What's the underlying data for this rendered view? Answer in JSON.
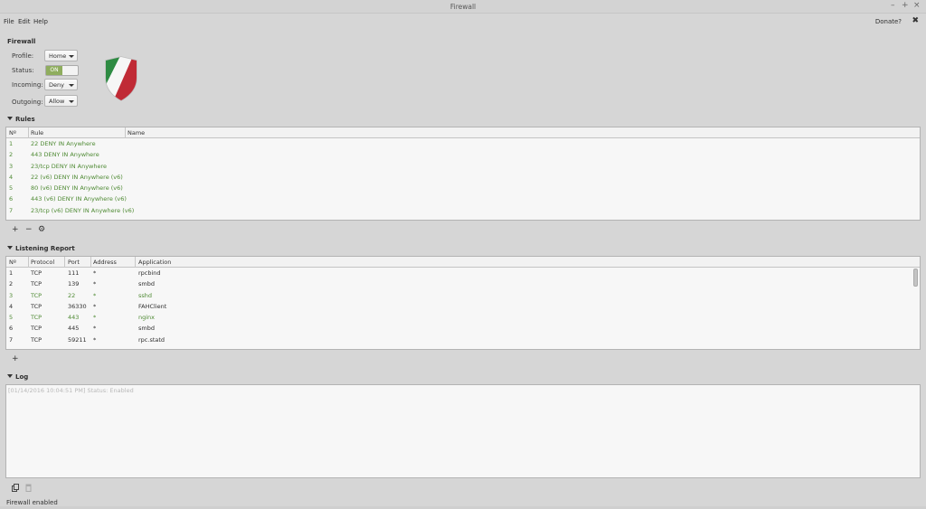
{
  "window": {
    "title": "Firewall",
    "controls": {
      "minimize": "–",
      "maximize": "+",
      "close": "×"
    }
  },
  "menu": {
    "file": "File",
    "edit": "Edit",
    "help": "Help"
  },
  "header": {
    "donate": "Donate?",
    "close_symbol": "✖"
  },
  "firewall": {
    "title": "Firewall",
    "profile_label": "Profile:",
    "profile_value": "Home",
    "status_label": "Status:",
    "status_value": "ON",
    "incoming_label": "Incoming:",
    "incoming_value": "Deny",
    "outgoing_label": "Outgoing:",
    "outgoing_value": "Allow"
  },
  "rules": {
    "title": "Rules",
    "columns": [
      "Nº",
      "Rule",
      "Name"
    ],
    "rows": [
      {
        "num": "1",
        "rule": "22 DENY IN Anywhere",
        "name": ""
      },
      {
        "num": "2",
        "rule": "443 DENY IN Anywhere",
        "name": ""
      },
      {
        "num": "3",
        "rule": "23/tcp DENY IN Anywhere",
        "name": ""
      },
      {
        "num": "4",
        "rule": "22 (v6) DENY IN Anywhere (v6)",
        "name": ""
      },
      {
        "num": "5",
        "rule": "80 (v6) DENY IN Anywhere (v6)",
        "name": ""
      },
      {
        "num": "6",
        "rule": "443 (v6) DENY IN Anywhere (v6)",
        "name": ""
      },
      {
        "num": "7",
        "rule": "23/tcp (v6) DENY IN Anywhere (v6)",
        "name": ""
      }
    ],
    "toolbar": {
      "add": "+",
      "remove": "−",
      "settings": "⚙"
    }
  },
  "report": {
    "title": "Listening Report",
    "columns": [
      "Nº",
      "Protocol",
      "Port",
      "Address",
      "Application"
    ],
    "rows": [
      {
        "num": "1",
        "protocol": "TCP",
        "port": "111",
        "address": "*",
        "application": "rpcbind",
        "highlight": false
      },
      {
        "num": "2",
        "protocol": "TCP",
        "port": "139",
        "address": "*",
        "application": "smbd",
        "highlight": false
      },
      {
        "num": "3",
        "protocol": "TCP",
        "port": "22",
        "address": "*",
        "application": "sshd",
        "highlight": true
      },
      {
        "num": "4",
        "protocol": "TCP",
        "port": "36330",
        "address": "*",
        "application": "FAHClient",
        "highlight": false
      },
      {
        "num": "5",
        "protocol": "TCP",
        "port": "443",
        "address": "*",
        "application": "nginx",
        "highlight": true
      },
      {
        "num": "6",
        "protocol": "TCP",
        "port": "445",
        "address": "*",
        "application": "smbd",
        "highlight": false
      },
      {
        "num": "7",
        "protocol": "TCP",
        "port": "59211",
        "address": "*",
        "application": "rpc.statd",
        "highlight": false
      }
    ],
    "toolbar": {
      "add": "+"
    }
  },
  "log": {
    "title": "Log",
    "lines": [
      "[01/14/2016 10:04:51 PM] Status: Enabled"
    ]
  },
  "statusbar": {
    "text": "Firewall enabled"
  },
  "colors": {
    "accent_green": "#4e8a33",
    "toggle_on": "#8fad5e"
  }
}
